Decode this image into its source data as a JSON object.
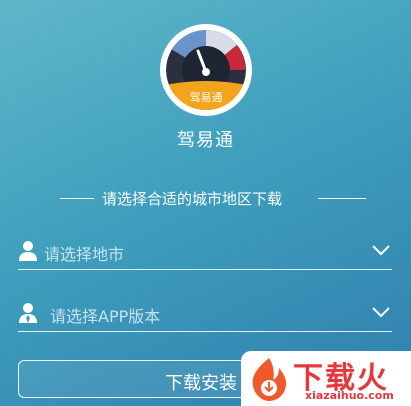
{
  "app": {
    "name": "驾易通",
    "logo_badge": "驾易通"
  },
  "form": {
    "section_title": "请选择合适的城市地区下载",
    "city_placeholder": "请选择地市",
    "version_placeholder": "请选择APP版本",
    "download_label": "下载安装"
  },
  "watermark": {
    "title": "下载火",
    "url": "xiazaihuo.com"
  },
  "icons": {
    "logo": "speedometer-icon",
    "city": "user-icon",
    "version": "user-tie-icon",
    "dropdown": "chevron-down-icon"
  },
  "colors": {
    "background_top": "#5fb7c9",
    "background_bottom": "#2f7fae",
    "gauge_badge": "#f2a51c",
    "watermark_red": "#e3383c"
  }
}
